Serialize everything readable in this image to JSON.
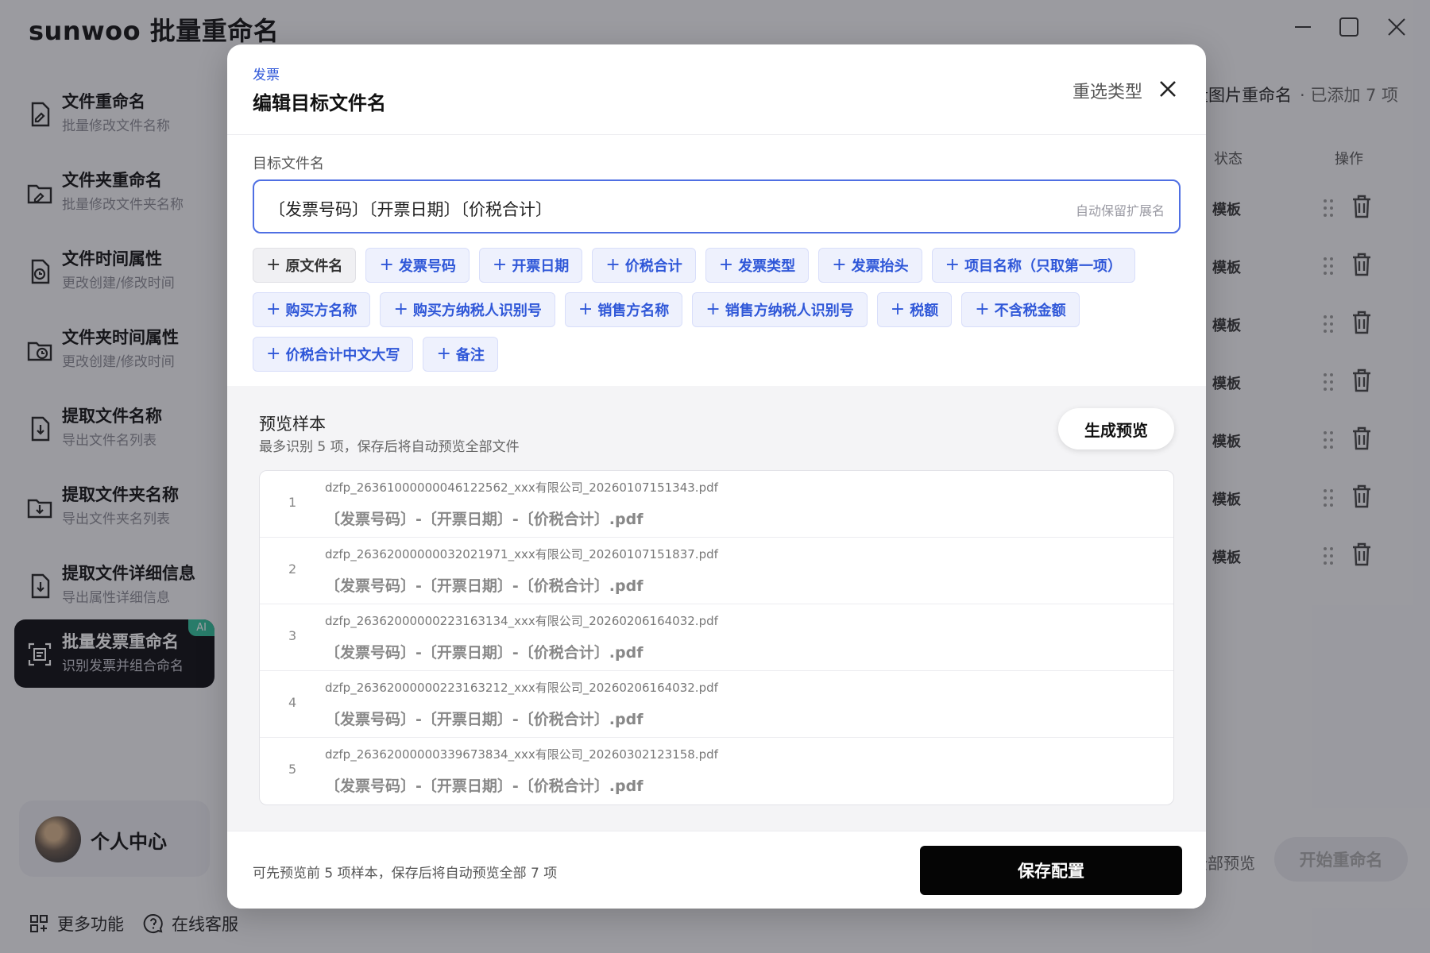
{
  "app": {
    "title": "sunwoo 批量重命名",
    "window_controls": [
      "minimize",
      "maximize",
      "close"
    ]
  },
  "sidebar": {
    "items": [
      {
        "title": "文件重命名",
        "subtitle": "批量修改文件名称",
        "icon": "file-rename-icon"
      },
      {
        "title": "文件夹重命名",
        "subtitle": "批量修改文件夹名称",
        "icon": "folder-rename-icon"
      },
      {
        "title": "文件时间属性",
        "subtitle": "更改创建/修改时间",
        "icon": "file-time-icon"
      },
      {
        "title": "文件夹时间属性",
        "subtitle": "更改创建/修改时间",
        "icon": "folder-time-icon"
      },
      {
        "title": "提取文件名称",
        "subtitle": "导出文件名列表",
        "icon": "file-export-icon"
      },
      {
        "title": "提取文件夹名称",
        "subtitle": "导出文件夹名列表",
        "icon": "folder-export-icon"
      },
      {
        "title": "提取文件详细信息",
        "subtitle": "导出属性详细信息",
        "icon": "file-detail-export-icon"
      },
      {
        "title": "批量发票重命名",
        "subtitle": "识别发票并组合命名",
        "icon": "invoice-scan-icon",
        "badge": "AI",
        "active": true
      }
    ],
    "profile": {
      "label": "个人中心"
    }
  },
  "bottom_bar": {
    "more": "更多功能",
    "service": "在线客服"
  },
  "background_main": {
    "header": "量图片重命名",
    "count": "· 已添加 7 项",
    "col_status": "状态",
    "col_action": "操作",
    "rows": [
      "模板",
      "模板",
      "模板",
      "模板",
      "模板",
      "模板",
      "模板"
    ],
    "preview_all": "全部预览",
    "start_rename": "开始重命名"
  },
  "modal": {
    "category": "发票",
    "title": "编辑目标文件名",
    "reselect": "重选类型",
    "field_label": "目标文件名",
    "input_value": "〔发票号码〕〔开票日期〕〔价税合计〕",
    "input_hint": "自动保留扩展名",
    "chip_rows": [
      [
        {
          "label": "原文件名",
          "neutral": true
        },
        {
          "label": "发票号码"
        },
        {
          "label": "开票日期"
        },
        {
          "label": "价税合计"
        },
        {
          "label": "发票类型"
        },
        {
          "label": "发票抬头"
        },
        {
          "label": "项目名称（只取第一项）"
        }
      ],
      [
        {
          "label": "购买方名称"
        },
        {
          "label": "购买方纳税人识别号"
        },
        {
          "label": "销售方名称"
        },
        {
          "label": "销售方纳税人识别号"
        },
        {
          "label": "税额"
        },
        {
          "label": "不含税金额"
        }
      ],
      [
        {
          "label": "价税合计中文大写"
        },
        {
          "label": "备注"
        }
      ]
    ],
    "preview": {
      "title": "预览样本",
      "subtitle": "最多识别 5 项，保存后将自动预览全部文件",
      "generate": "生成预览",
      "rows": [
        {
          "index": "1",
          "original": "dzfp_26361000000046122562_xxx有限公司_20260107151343.pdf",
          "result": "〔发票号码〕-〔开票日期〕-〔价税合计〕.pdf"
        },
        {
          "index": "2",
          "original": "dzfp_26362000000032021971_xxx有限公司_20260107151837.pdf",
          "result": "〔发票号码〕-〔开票日期〕-〔价税合计〕.pdf"
        },
        {
          "index": "3",
          "original": "dzfp_26362000000223163134_xxx有限公司_20260206164032.pdf",
          "result": "〔发票号码〕-〔开票日期〕-〔价税合计〕.pdf"
        },
        {
          "index": "4",
          "original": "dzfp_26362000000223163212_xxx有限公司_20260206164032.pdf",
          "result": "〔发票号码〕-〔开票日期〕-〔价税合计〕.pdf"
        },
        {
          "index": "5",
          "original": "dzfp_26362000000339673834_xxx有限公司_20260302123158.pdf",
          "result": "〔发票号码〕-〔开票日期〕-〔价税合计〕.pdf"
        }
      ]
    },
    "footer_note": "可先预览前 5 项样本，保存后将自动预览全部 7 项",
    "save": "保存配置"
  },
  "colors": {
    "accent": "#2f57d8",
    "chip_bg": "#eef1fd",
    "active_nav": "#0c0c0f",
    "ai_badge": "#2fbf9a",
    "primary_button": "#050505"
  }
}
